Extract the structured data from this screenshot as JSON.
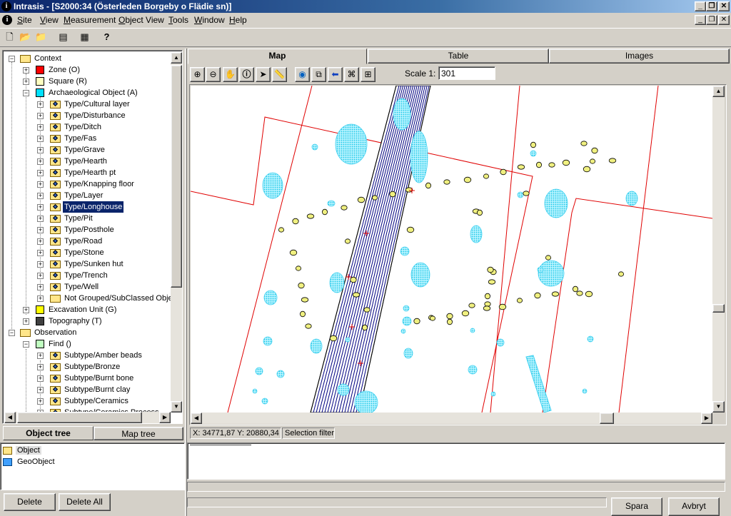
{
  "window": {
    "title": "Intrasis - [S2000:34 (Österleden Borgeby o Flädie sn)]",
    "app_icon": "info-icon"
  },
  "menu": [
    "Site",
    "View",
    "Measurement",
    "Object View",
    "Tools",
    "Window",
    "Help"
  ],
  "toolbar_icons": [
    "new-icon",
    "open-icon",
    "save-icon",
    "list-icon",
    "grid-icon",
    "help-icon"
  ],
  "tree": {
    "context_label": "Context",
    "zone": "Zone (O)",
    "square": "Square (R)",
    "archaeological_object": "Archaeological Object (A)",
    "types": [
      "Type/Cultural layer",
      "Type/Disturbance",
      "Type/Ditch",
      "Type/Fas",
      "Type/Grave",
      "Type/Hearth",
      "Type/Hearth pt",
      "Type/Knapping floor",
      "Type/Layer",
      "Type/Longhouse",
      "Type/Pit",
      "Type/Posthole",
      "Type/Road",
      "Type/Stone",
      "Type/Sunken hut",
      "Type/Trench",
      "Type/Well",
      "Not Grouped/SubClassed Obje"
    ],
    "selected_type": "Type/Longhouse",
    "excavation_unit": "Excavation Unit (G)",
    "topography": "Topography (T)",
    "observation": "Observation",
    "find": "Find ()",
    "subtypes": [
      "Subtype/Amber beads",
      "Subtype/Bronze",
      "Subtype/Burnt bone",
      "Subtype/Burnt clay",
      "Subtype/Ceramics",
      "Subtype/Ceramics Process"
    ],
    "colors": {
      "zone": "#ff0000",
      "square": "#ffffc0",
      "archaeological_object": "#00e0ff",
      "excavation_unit": "#ffff00",
      "topography": "#404040",
      "find": "#c0ffc0"
    }
  },
  "left_tabs": [
    "Object tree",
    "Map tree"
  ],
  "left_tab_active": "Object tree",
  "selection_list": [
    "Object",
    "GeoObject"
  ],
  "left_buttons": [
    "Delete",
    "Delete All"
  ],
  "right_tabs": [
    "Map",
    "Table",
    "Images"
  ],
  "right_tab_active": "Map",
  "map_tools": [
    "zoom-in-icon",
    "zoom-out-icon",
    "pan-hand-icon",
    "info-icon",
    "pointer-icon",
    "measure-ruler-icon",
    "globe-icon",
    "layers-icon",
    "back-arrow-icon",
    "binoculars-icon",
    "select-area-icon"
  ],
  "scale": {
    "label": "Scale 1:",
    "value": "301"
  },
  "status": {
    "coords": "X: 34771,87 Y: 20880,34",
    "mode": "Selection filter"
  },
  "bottom_buttons": [
    "Spara",
    "Avbryt"
  ],
  "map_colors": {
    "feature_fill": "#80f0ff",
    "posthole_fill": "#f0f080",
    "boundary": "#e00000",
    "hatch": "#000080"
  }
}
